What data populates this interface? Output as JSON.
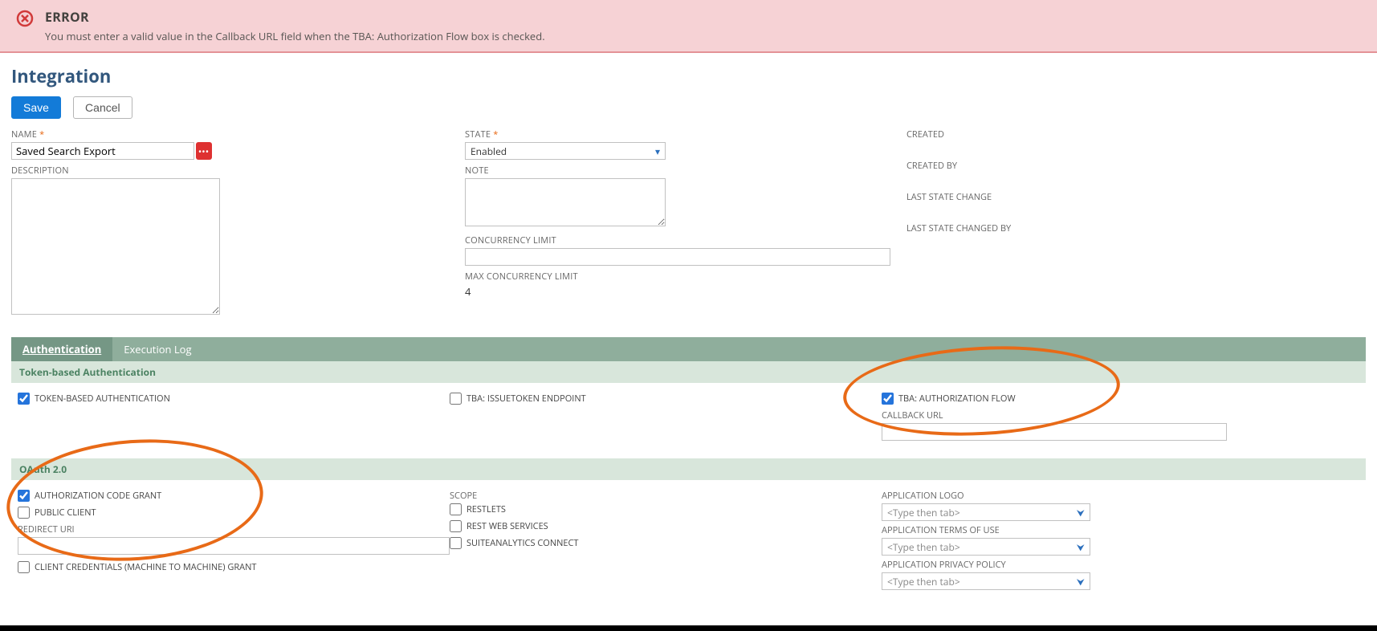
{
  "error": {
    "title": "ERROR",
    "message": "You must enter a valid value in the Callback URL field when the TBA: Authorization Flow box is checked."
  },
  "page_title": "Integration",
  "buttons": {
    "save": "Save",
    "cancel": "Cancel"
  },
  "form": {
    "name_label": "NAME",
    "name_value": "Saved Search Export",
    "description_label": "DESCRIPTION",
    "description_value": "",
    "state_label": "STATE",
    "state_value": "Enabled",
    "note_label": "NOTE",
    "note_value": "",
    "concurrency_label": "CONCURRENCY LIMIT",
    "concurrency_value": "",
    "max_conc_label": "MAX CONCURRENCY LIMIT",
    "max_conc_value": "4",
    "meta": {
      "created": "CREATED",
      "created_by": "CREATED BY",
      "last_state_change": "LAST STATE CHANGE",
      "last_state_changed_by": "LAST STATE CHANGED BY"
    }
  },
  "tabs": {
    "auth": "Authentication",
    "log": "Execution Log"
  },
  "section_tba": {
    "heading": "Token-based Authentication",
    "tba_chk": "TOKEN-BASED AUTHENTICATION",
    "tba_issue": "TBA: ISSUETOKEN ENDPOINT",
    "tba_flow": "TBA: AUTHORIZATION FLOW",
    "callback_label": "CALLBACK URL",
    "callback_value": ""
  },
  "section_oauth": {
    "heading": "OAuth 2.0",
    "auth_code": "AUTHORIZATION CODE GRANT",
    "public_client": "PUBLIC CLIENT",
    "redirect_label": "REDIRECT URI",
    "redirect_value": "",
    "client_cred": "CLIENT CREDENTIALS (MACHINE TO MACHINE) GRANT",
    "scope_label": "SCOPE",
    "restlets": "RESTLETS",
    "rest_ws": "REST WEB SERVICES",
    "suiteanalytics": "SUITEANALYTICS CONNECT",
    "app_logo_label": "APPLICATION LOGO",
    "app_terms_label": "APPLICATION TERMS OF USE",
    "app_privacy_label": "APPLICATION PRIVACY POLICY",
    "dd_placeholder": "<Type then tab>"
  }
}
